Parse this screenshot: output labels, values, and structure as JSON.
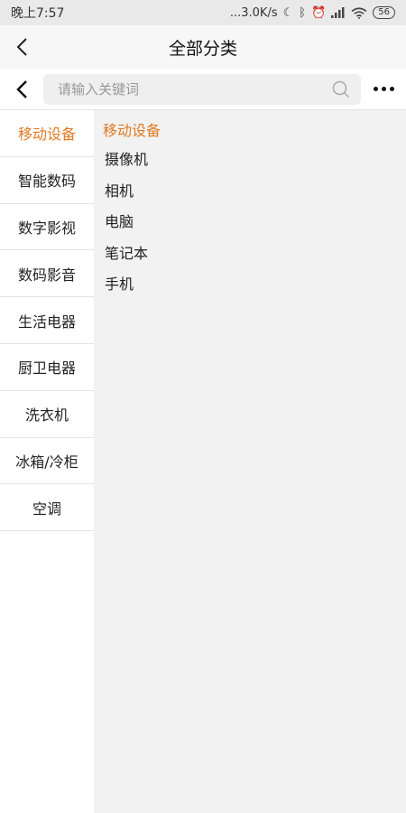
{
  "status_bar": {
    "time": "晚上7:57",
    "network_speed": "...3.0K/s",
    "battery": "56"
  },
  "header": {
    "title": "全部分类"
  },
  "search": {
    "placeholder": "请输入关键词"
  },
  "sidebar": {
    "items": [
      {
        "label": "移动设备",
        "active": true
      },
      {
        "label": "智能数码"
      },
      {
        "label": "数字影视"
      },
      {
        "label": "数码影音"
      },
      {
        "label": "生活电器"
      },
      {
        "label": "厨卫电器"
      },
      {
        "label": "洗衣机"
      },
      {
        "label": "冰箱/冷柜"
      },
      {
        "label": "空调"
      }
    ]
  },
  "panel": {
    "title": "移动设备",
    "items": [
      "摄像机",
      "相机",
      "电脑",
      "笔记本",
      "手机"
    ]
  },
  "colors": {
    "accent": "#e07a22",
    "panel_bg": "#f2f2f2"
  }
}
